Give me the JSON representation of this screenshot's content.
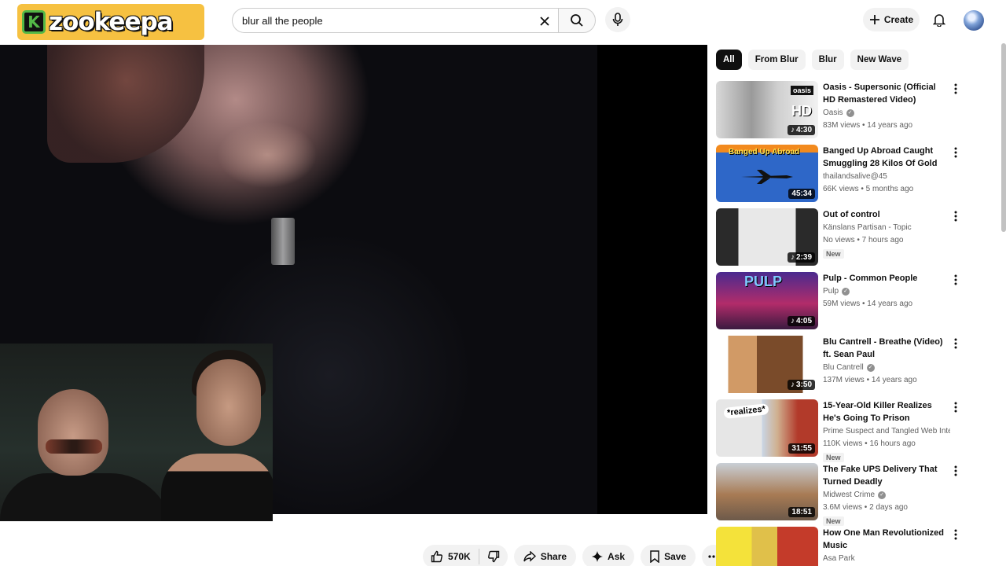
{
  "header": {
    "logo_letter": "K",
    "logo_text": "zookeepa",
    "search_value": "blur all the people",
    "create_label": "Create"
  },
  "actions": {
    "like_count": "570K",
    "share_label": "Share",
    "ask_label": "Ask",
    "save_label": "Save"
  },
  "chips": [
    "All",
    "From Blur",
    "Blur",
    "New Wave"
  ],
  "recommendations": [
    {
      "title": "Oasis - Supersonic (Official HD Remastered Video)",
      "channel": "Oasis",
      "verified": true,
      "meta": "83M views • 14 years ago",
      "duration": "4:30",
      "new": false
    },
    {
      "title": "Banged Up Abroad Caught Smuggling 28 Kilos Of Gold (T...",
      "channel": "thailandsalive@45",
      "verified": false,
      "meta": "66K views • 5 months ago",
      "duration": "45:34",
      "new": false
    },
    {
      "title": "Out of control",
      "channel": "Känslans Partisan - Topic",
      "verified": false,
      "meta": "No views • 7 hours ago",
      "duration": "2:39",
      "new": true
    },
    {
      "title": "Pulp - Common People",
      "channel": "Pulp",
      "verified": true,
      "meta": "59M views • 14 years ago",
      "duration": "4:05",
      "new": false
    },
    {
      "title": "Blu Cantrell - Breathe (Video) ft. Sean Paul",
      "channel": "Blu Cantrell",
      "verified": true,
      "meta": "137M views • 14 years ago",
      "duration": "3:50",
      "new": false
    },
    {
      "title": "15-Year-Old Killer Realizes He's Going To Prison",
      "channel": "Prime Suspect and Tangled Web Interrog...",
      "verified": false,
      "meta": "110K views • 16 hours ago",
      "duration": "31:55",
      "new": true
    },
    {
      "title": "The Fake UPS Delivery That Turned Deadly",
      "channel": "Midwest Crime",
      "verified": true,
      "meta": "3.6M views • 2 days ago",
      "duration": "18:51",
      "new": true
    },
    {
      "title": "How One Man Revolutionized Music",
      "channel": "Asa Park",
      "verified": false,
      "meta": "",
      "duration": "",
      "new": false
    }
  ],
  "thumb_labels": {
    "oasis": "oasis",
    "hd": "HD",
    "banged": "Banged Up Abroad",
    "realizes": "*realizes*",
    "pulp": "PULP"
  },
  "new_badge": "New"
}
